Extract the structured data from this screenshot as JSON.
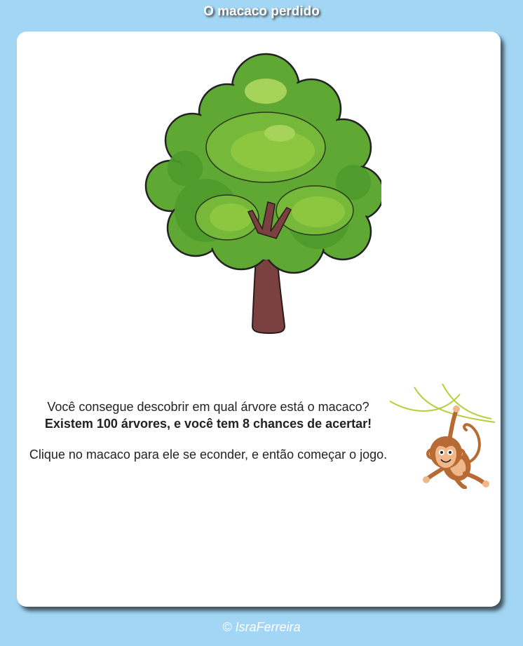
{
  "header": {
    "title": "O macaco perdido"
  },
  "game": {
    "intro_line1": "Você consegue descobrir em qual árvore está o macaco?",
    "intro_line2": "Existem 100 árvores, e você tem 8 chances de acertar!",
    "instruction": "Clique no macaco para ele se econder, e então começar o jogo."
  },
  "icons": {
    "tree": "tree-icon",
    "monkey": "monkey-icon"
  },
  "footer": {
    "credit": "© IsraFerreira"
  },
  "colors": {
    "background": "#a3d6f5",
    "card": "#ffffff",
    "tree_trunk": "#7b4040",
    "foliage_dark": "#4e9a2b",
    "foliage_light": "#8dc63f",
    "monkey_brown": "#b86a35"
  }
}
